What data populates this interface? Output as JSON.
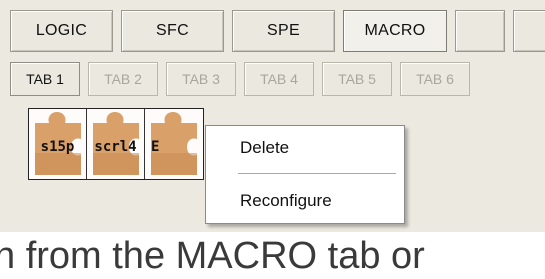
{
  "toolbar": {
    "buttons": [
      {
        "label": "LOGIC",
        "active": false
      },
      {
        "label": "SFC",
        "active": false
      },
      {
        "label": "SPE",
        "active": false
      },
      {
        "label": "MACRO",
        "active": true
      },
      {
        "label": "",
        "active": false
      },
      {
        "label": "",
        "active": false
      }
    ]
  },
  "tabs": [
    {
      "label": "TAB 1",
      "active": true
    },
    {
      "label": "TAB 2",
      "active": false
    },
    {
      "label": "TAB 3",
      "active": false
    },
    {
      "label": "TAB 4",
      "active": false
    },
    {
      "label": "TAB 5",
      "active": false
    },
    {
      "label": "TAB 6",
      "active": false
    }
  ],
  "macro_tiles": [
    {
      "label": "s15p",
      "icon": "puzzle-piece-icon"
    },
    {
      "label": "scrl4",
      "icon": "puzzle-piece-icon"
    },
    {
      "label": "E",
      "icon": "puzzle-piece-icon"
    }
  ],
  "context_menu": {
    "items": [
      "Delete",
      "Reconfigure"
    ]
  },
  "caption": "n from the MACRO tab or",
  "colors": {
    "panel_bg": "#ece9e0",
    "puzzle": "#d9a06a",
    "puzzle_shadow": "#b97a45"
  }
}
